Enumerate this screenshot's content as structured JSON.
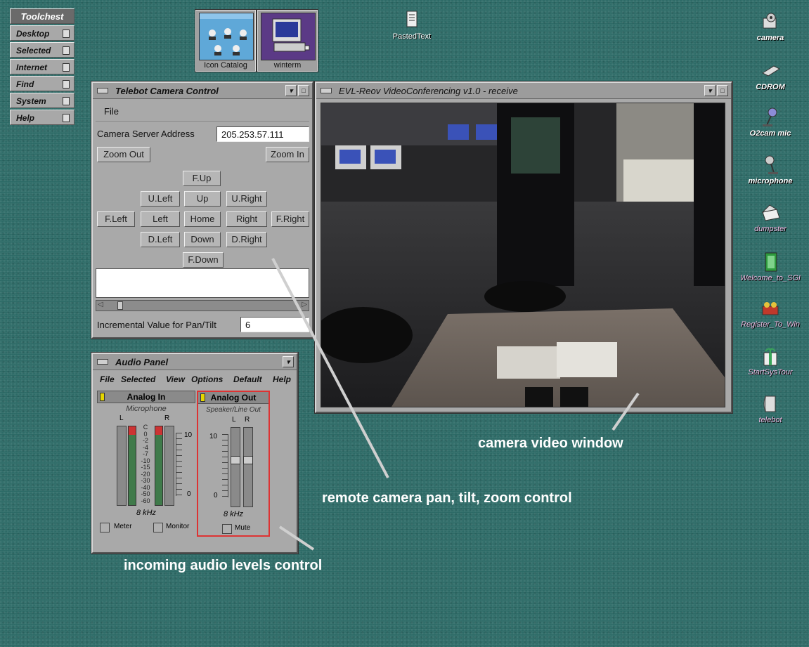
{
  "toolchest": {
    "title": "Toolchest",
    "items": [
      "Desktop",
      "Selected",
      "Internet",
      "Find",
      "System",
      "Help"
    ]
  },
  "minimized": [
    {
      "label": "Icon Catalog"
    },
    {
      "label": "winterm"
    }
  ],
  "desktop_icons": [
    {
      "label": "PastedText",
      "icon": "document-icon"
    },
    {
      "label": "camera",
      "icon": "camera-icon"
    },
    {
      "label": "CDROM",
      "icon": "cdrom-icon"
    },
    {
      "label": "O2cam mic",
      "icon": "microphone-icon"
    },
    {
      "label": "microphone",
      "icon": "microphone-icon"
    },
    {
      "label": "dumpster",
      "icon": "dumpster-icon"
    },
    {
      "label": "Welcome_to_SGI",
      "icon": "door-icon"
    },
    {
      "label": "Register_To_Win",
      "icon": "gift-icon"
    },
    {
      "label": "StartSysTour",
      "icon": "gift-box-icon"
    },
    {
      "label": "telebot",
      "icon": "folder-icon"
    }
  ],
  "camera_control": {
    "title": "Telebot Camera Control",
    "menu": "File",
    "server_label": "Camera Server Address",
    "server_value": "205.253.57.111",
    "zoom_out": "Zoom Out",
    "zoom_in": "Zoom In",
    "buttons": {
      "f_up": "F.Up",
      "u_left": "U.Left",
      "up": "Up",
      "u_right": "U.Right",
      "f_left": "F.Left",
      "left": "Left",
      "home": "Home",
      "right": "Right",
      "f_right": "F.Right",
      "d_left": "D.Left",
      "down": "Down",
      "d_right": "D.Right",
      "f_down": "F.Down"
    },
    "increment_label": "Incremental Value for Pan/Tilt",
    "increment_value": "6"
  },
  "video_window": {
    "title": "EVL-Reov VideoConferencing v1.0 - receive"
  },
  "audio_panel": {
    "title": "Audio Panel",
    "menu": [
      "File",
      "Selected",
      "View",
      "Options",
      "Default",
      "Help"
    ],
    "analog_in": {
      "header": "Analog In",
      "source": "Microphone",
      "left": "L",
      "right": "R",
      "scale": [
        "C",
        "0",
        "-2",
        "-4",
        "-7",
        "-10",
        "-15",
        "-20",
        "-30",
        "-40",
        "-50",
        "-60"
      ],
      "tick_10": "10",
      "tick_0": "0",
      "rate": "8 kHz",
      "meter_label": "Meter",
      "monitor_label": "Monitor"
    },
    "analog_out": {
      "header": "Analog Out",
      "source": "Speaker/Line Out",
      "left": "L",
      "right": "R",
      "tick_10": "10",
      "tick_0": "0",
      "rate": "8 kHz",
      "mute_label": "Mute"
    }
  },
  "annotations": {
    "video": "camera video window",
    "ptz": "remote camera pan, tilt, zoom control",
    "audio": "incoming audio levels control"
  }
}
